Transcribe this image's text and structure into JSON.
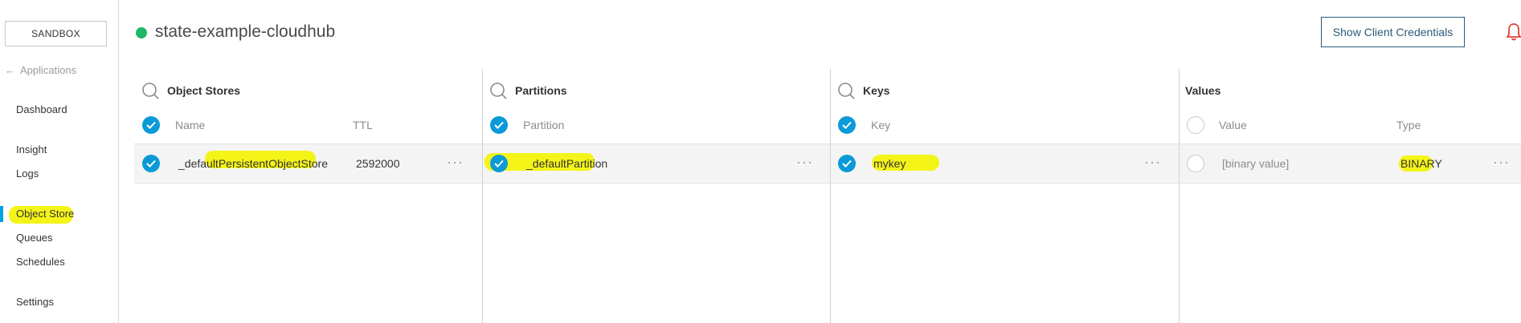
{
  "sidebar": {
    "environment": "SANDBOX",
    "back_label": "Applications",
    "items": [
      {
        "label": "Dashboard"
      },
      {
        "label": "Insight"
      },
      {
        "label": "Logs"
      },
      {
        "label": "Object Store",
        "active": true
      },
      {
        "label": "Queues"
      },
      {
        "label": "Schedules"
      },
      {
        "label": "Settings"
      }
    ]
  },
  "header": {
    "app_name": "state-example-cloudhub",
    "status_color": "#1fb868",
    "credentials_button": "Show Client Credentials",
    "notification_icon": "bell-icon"
  },
  "columns": {
    "object_stores": {
      "title": "Object Stores",
      "headers": [
        "Name",
        "TTL"
      ],
      "rows": [
        {
          "name": "_defaultPersistentObjectStore",
          "ttl": "2592000"
        }
      ]
    },
    "partitions": {
      "title": "Partitions",
      "headers": [
        "Partition"
      ],
      "rows": [
        {
          "name": "_defaultPartition"
        }
      ]
    },
    "keys": {
      "title": "Keys",
      "headers": [
        "Key"
      ],
      "rows": [
        {
          "name": "mykey"
        }
      ]
    },
    "values": {
      "title": "Values",
      "headers": [
        "Value",
        "Type"
      ],
      "rows": [
        {
          "value": "[binary value]",
          "type": "BINARY"
        }
      ]
    }
  },
  "colors": {
    "accent": "#0a9ad8",
    "highlight": "#f4f418",
    "button_border": "#2b5a78"
  },
  "icons": {
    "row_menu": "more-horizontal-icon",
    "check": "check-circle-icon",
    "search": "search-icon"
  }
}
